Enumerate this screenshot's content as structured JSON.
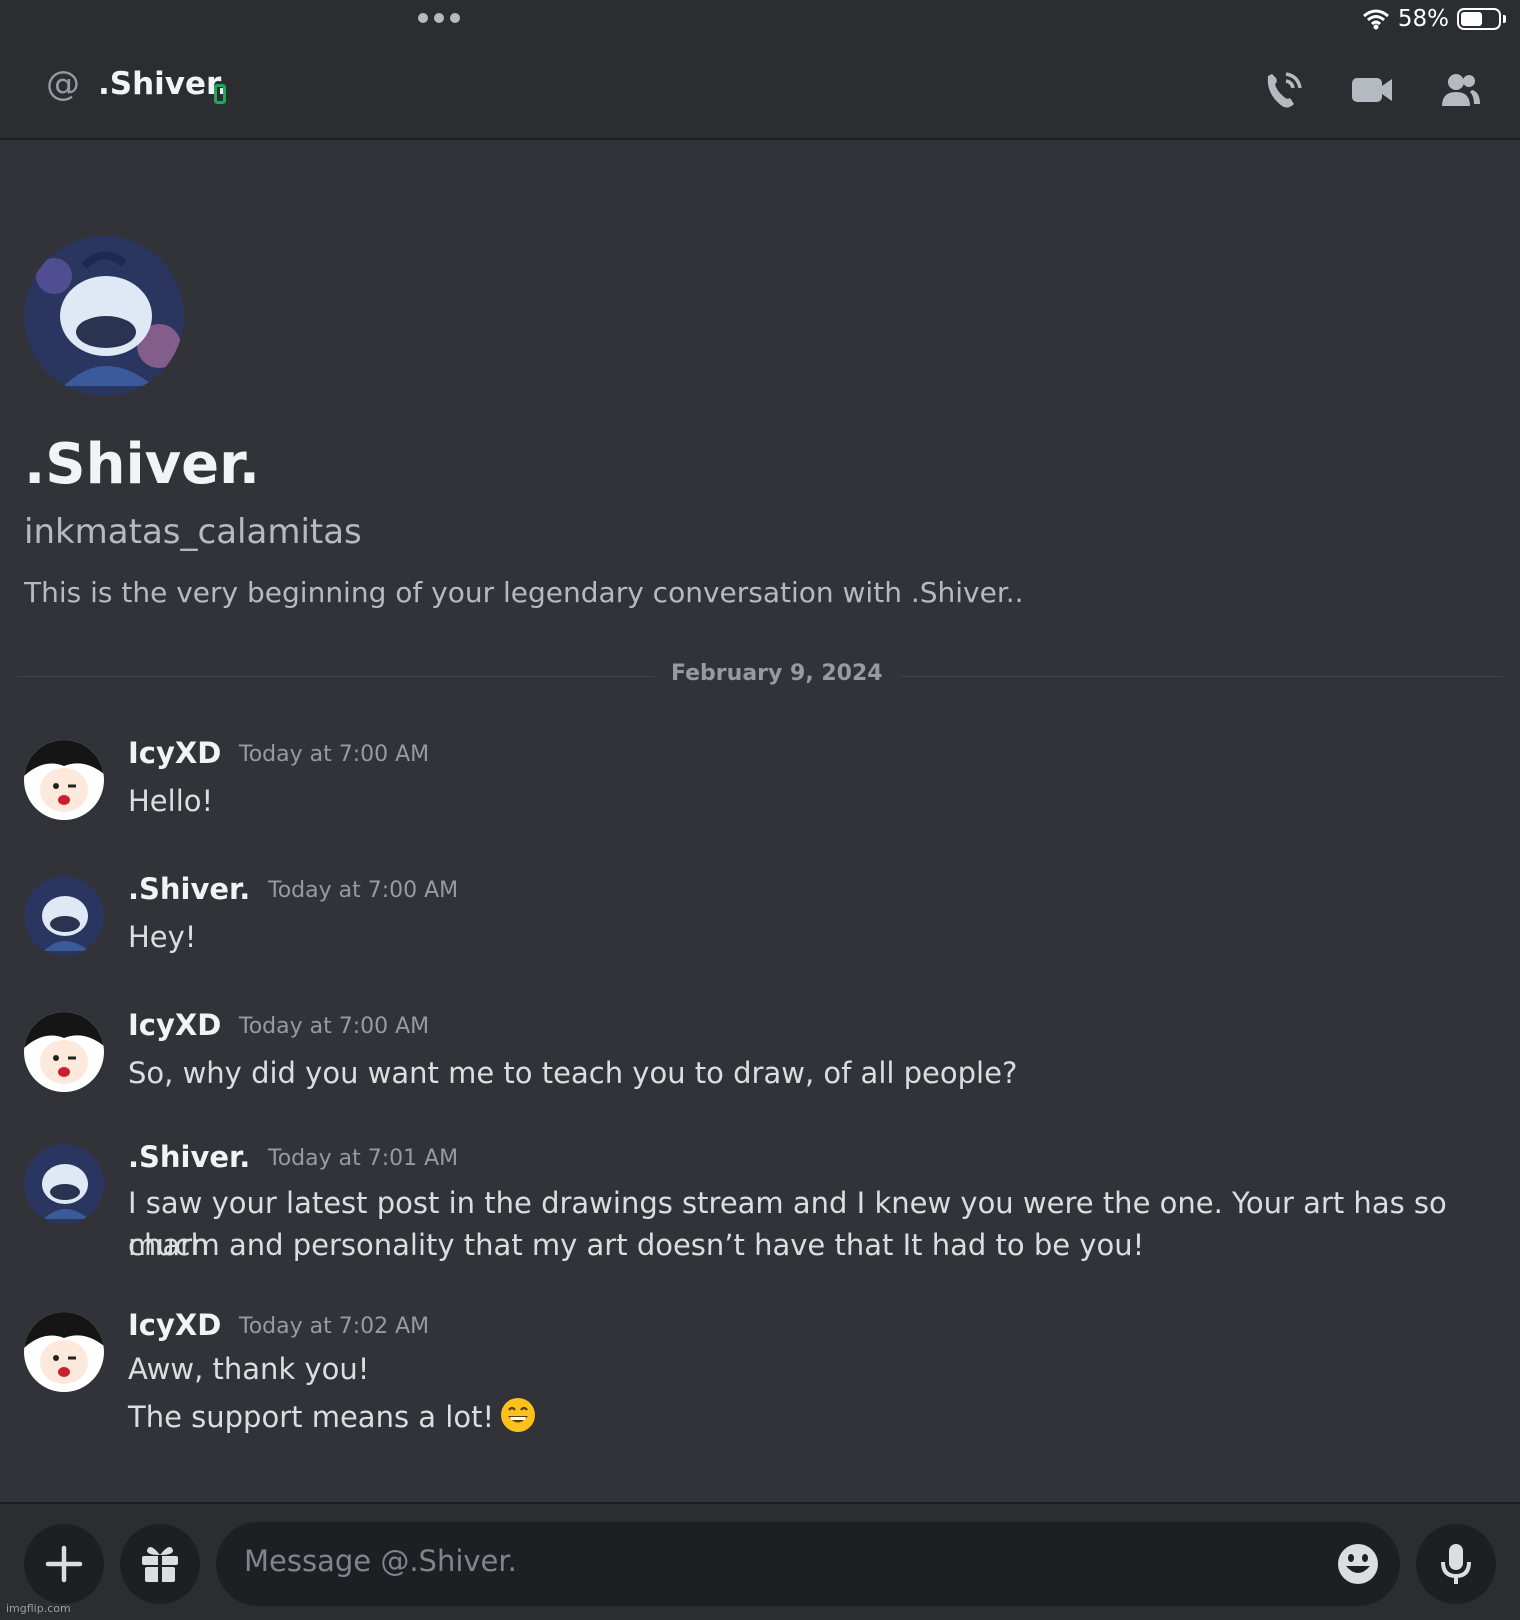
{
  "status_bar": {
    "battery_text": "58%",
    "battery_level": 0.58
  },
  "header": {
    "at_symbol": "@",
    "title": ".Shiver."
  },
  "intro": {
    "display_name": ".Shiver.",
    "username": "inkmatas_calamitas",
    "text": "This is the very beginning of your legendary conversation with .Shiver.."
  },
  "date_divider": "February 9, 2024",
  "messages": [
    {
      "author": "IcyXD",
      "time": "Today at 7:00 AM",
      "lines": [
        "Hello!"
      ]
    },
    {
      "author": ".Shiver.",
      "time": "Today at 7:00 AM",
      "lines": [
        "Hey!"
      ]
    },
    {
      "author": "IcyXD",
      "time": "Today at 7:00 AM",
      "lines": [
        "So, why did you want me to teach you to draw, of all people?"
      ]
    },
    {
      "author": ".Shiver.",
      "time": "Today at 7:01 AM",
      "lines": [
        "I saw your latest post in the drawings stream and I knew you were the one. Your art has so much",
        "charm and personality that my art doesn’t have that It had to be you!"
      ]
    },
    {
      "author": "IcyXD",
      "time": "Today at 7:02 AM",
      "lines": [
        "Aww, thank you!",
        "The support means a lot!"
      ]
    }
  ],
  "composer": {
    "placeholder": "Message @.Shiver."
  },
  "watermark": "imgflip.com",
  "colors": {
    "background": "#313338",
    "header": "#2b2d31",
    "online_mobile": "#23a55a"
  }
}
